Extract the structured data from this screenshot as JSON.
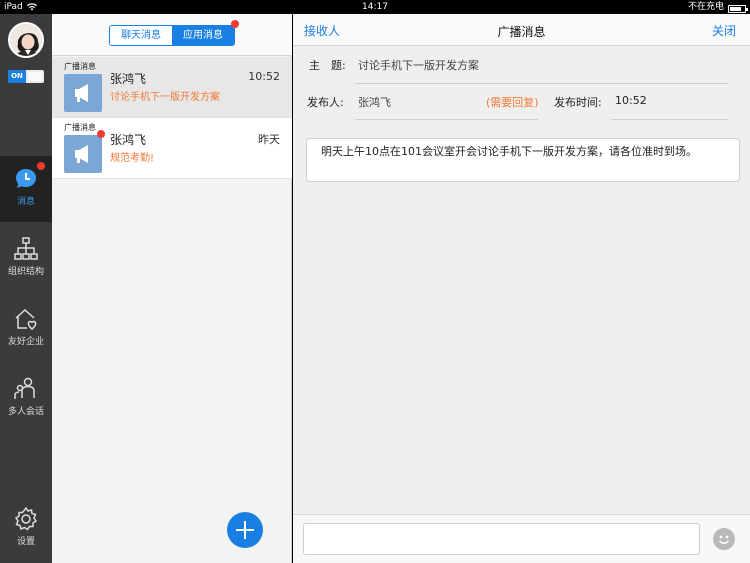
{
  "status_bar": {
    "device": "iPad",
    "time": "14:17",
    "charging": "不在充电",
    "battery_level": 0.8
  },
  "nav": {
    "toggle_label": "ON",
    "items": [
      {
        "label": "消息",
        "icon": "chat-bubble-icon"
      },
      {
        "label": "组织结构",
        "icon": "org-chart-icon"
      },
      {
        "label": "友好企业",
        "icon": "house-heart-icon"
      },
      {
        "label": "多人会话",
        "icon": "group-chat-icon"
      },
      {
        "label": "设置",
        "icon": "gear-icon"
      }
    ]
  },
  "list": {
    "tabs": [
      {
        "label": "聊天消息"
      },
      {
        "label": "应用消息"
      }
    ],
    "items": [
      {
        "tag": "广播消息",
        "name": "张鸿飞",
        "time": "10:52",
        "message": "讨论手机下一版开发方案"
      },
      {
        "tag": "广播消息",
        "name": "张鸿飞",
        "time": "昨天",
        "message": "规范考勤!"
      }
    ]
  },
  "detail": {
    "left_action": "接收人",
    "title": "广播消息",
    "right_action": "关闭",
    "subject_label": "主　题:",
    "subject_value": "讨论手机下一版开发方案",
    "publisher_label": "发布人:",
    "publisher_value": "张鸿飞",
    "reply_note": "(需要回复)",
    "publish_time_label": "发布时间:",
    "publish_time_value": "10:52",
    "content": "明天上午10点在101会议室开会讨论手机下一版开发方案，请各位准时到场。"
  },
  "colors": {
    "accent": "#1a7fe3",
    "highlight": "#f07a38",
    "badge": "#f03a32"
  }
}
